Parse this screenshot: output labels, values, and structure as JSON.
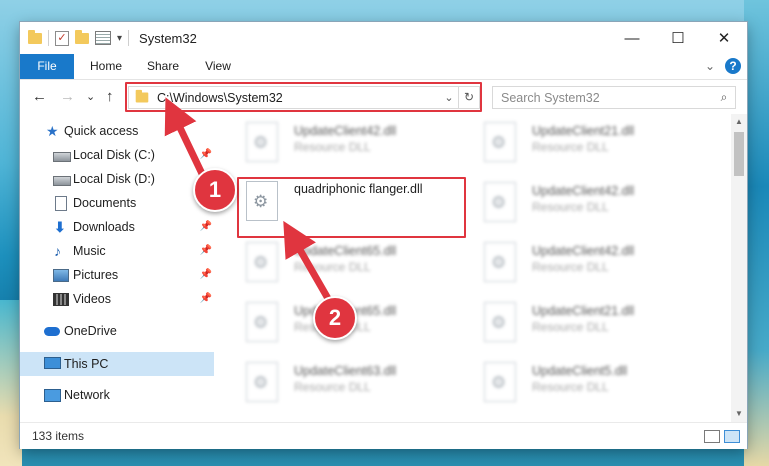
{
  "window": {
    "title": "System32",
    "qat_dropdown": "▾",
    "minimize": "—",
    "maximize": "☐",
    "close": "✕"
  },
  "ribbon": {
    "tabs": [
      "File",
      "Home",
      "Share",
      "View"
    ],
    "chevron": "⌄",
    "help": "?"
  },
  "address": {
    "back": "←",
    "forward": "→",
    "recent": "⌄",
    "up": "↑",
    "path": "C:\\Windows\\System32",
    "dropdown": "⌄",
    "refresh": "↻",
    "search_placeholder": "Search System32",
    "search_icon_glyph": "⌕"
  },
  "nav_pane": {
    "items": [
      {
        "label": "Quick access",
        "icon": "star-icon",
        "pinned": false
      },
      {
        "label": "Local Disk (C:)",
        "icon": "drive-icon",
        "pinned": true
      },
      {
        "label": "Local Disk (D:)",
        "icon": "drive-icon",
        "pinned": true
      },
      {
        "label": "Documents",
        "icon": "documents-icon",
        "pinned": true
      },
      {
        "label": "Downloads",
        "icon": "downloads-icon",
        "pinned": true
      },
      {
        "label": "Music",
        "icon": "music-icon",
        "pinned": true
      },
      {
        "label": "Pictures",
        "icon": "pictures-icon",
        "pinned": true
      },
      {
        "label": "Videos",
        "icon": "videos-icon",
        "pinned": true
      },
      {
        "label": "OneDrive",
        "icon": "onedrive-icon",
        "pinned": false
      },
      {
        "label": "This PC",
        "icon": "this-pc-icon",
        "pinned": false
      },
      {
        "label": "Network",
        "icon": "network-icon",
        "pinned": false
      }
    ],
    "pin_glyph": "📌"
  },
  "files": {
    "left": [
      {
        "name": "UpdateClient42.dll",
        "type": "Resource DLL"
      },
      {
        "name": "quadriphonic flanger.dll",
        "type": ""
      },
      {
        "name": "UpdateClient65.dll",
        "type": "Resource DLL"
      },
      {
        "name": "UpdateClient65.dll",
        "type": "Resource DLL"
      },
      {
        "name": "UpdateClient63.dll",
        "type": "Resource DLL"
      }
    ],
    "right": [
      {
        "name": "UpdateClient21.dll",
        "type": "Resource DLL"
      },
      {
        "name": "UpdateClient42.dll",
        "type": "Resource DLL"
      },
      {
        "name": "UpdateClient42.dll",
        "type": "Resource DLL"
      },
      {
        "name": "UpdateClient21.dll",
        "type": "Resource DLL"
      },
      {
        "name": "UpdateClient5.dll",
        "type": "Resource DLL"
      }
    ]
  },
  "status": {
    "item_count": "133 items"
  },
  "annotations": {
    "step1": "1",
    "step2": "2",
    "color": "#e0353f"
  },
  "colors": {
    "file_tab": "#1979ca",
    "selection": "#cce4f7"
  }
}
